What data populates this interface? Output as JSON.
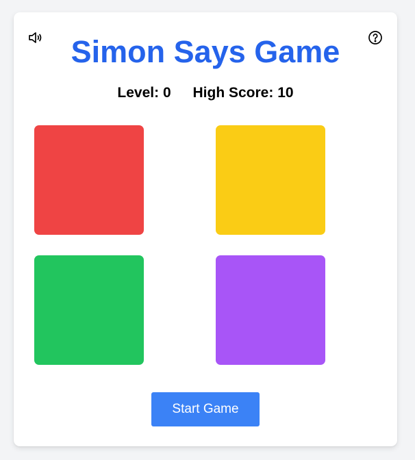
{
  "title": "Simon Says Game",
  "stats": {
    "level_label": "Level:",
    "level_value": "0",
    "high_score_label": "High Score:",
    "high_score_value": "10"
  },
  "controls": {
    "sound_icon": "speaker-volume-icon",
    "help_icon": "question-circle-icon",
    "start_label": "Start Game"
  },
  "pads": [
    {
      "name": "red",
      "color": "#ef4444"
    },
    {
      "name": "yellow",
      "color": "#facc15"
    },
    {
      "name": "green",
      "color": "#22c55e"
    },
    {
      "name": "purple",
      "color": "#a855f7"
    }
  ],
  "colors": {
    "title": "#2563eb",
    "button": "#3b82f6",
    "background": "#f3f4f6"
  }
}
